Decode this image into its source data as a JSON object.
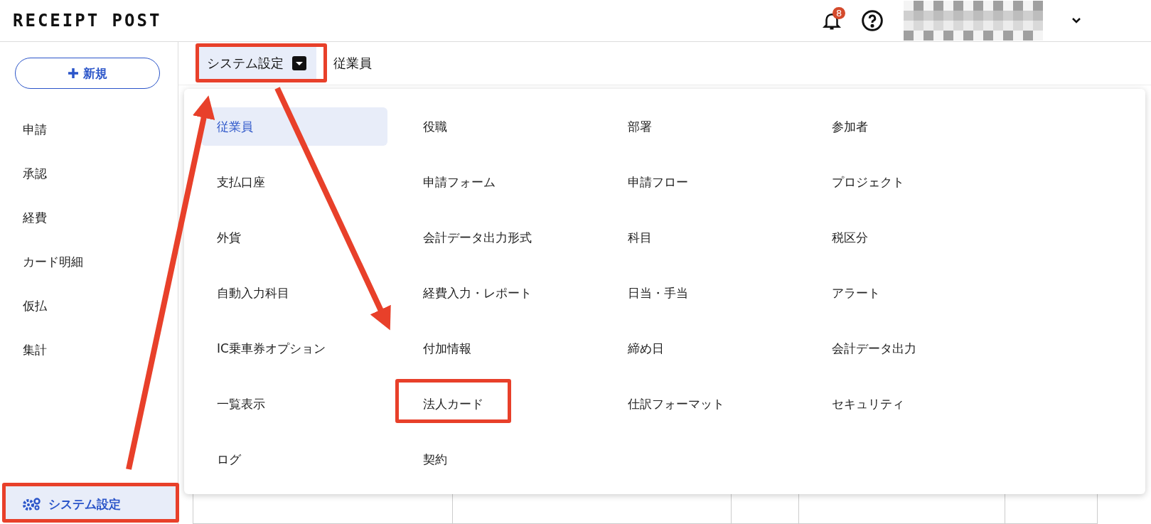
{
  "header": {
    "logo": "RECEIPT POST",
    "notification_count": "8"
  },
  "sidebar": {
    "new_button": "新規",
    "items": [
      {
        "label": "申請",
        "selected": false
      },
      {
        "label": "承認",
        "selected": false
      },
      {
        "label": "経費",
        "selected": false
      },
      {
        "label": "カード明細",
        "selected": false
      },
      {
        "label": "仮払",
        "selected": false
      },
      {
        "label": "集計",
        "selected": false
      }
    ],
    "bottom_item": {
      "label": "システム設定",
      "selected": true
    }
  },
  "tabs": [
    {
      "label": "システム設定",
      "kind": "dropdown",
      "selected": true
    },
    {
      "label": "従業員",
      "kind": "plain",
      "selected": false
    }
  ],
  "menu_items": [
    {
      "label": "従業員",
      "selected": true
    },
    {
      "label": "役職",
      "selected": false
    },
    {
      "label": "部署",
      "selected": false
    },
    {
      "label": "参加者",
      "selected": false
    },
    {
      "label": "支払口座",
      "selected": false
    },
    {
      "label": "申請フォーム",
      "selected": false
    },
    {
      "label": "申請フロー",
      "selected": false
    },
    {
      "label": "プロジェクト",
      "selected": false
    },
    {
      "label": "外貨",
      "selected": false
    },
    {
      "label": "会計データ出力形式",
      "selected": false
    },
    {
      "label": "科目",
      "selected": false
    },
    {
      "label": "税区分",
      "selected": false
    },
    {
      "label": "自動入力科目",
      "selected": false
    },
    {
      "label": "経費入力・レポート",
      "selected": false
    },
    {
      "label": "日当・手当",
      "selected": false
    },
    {
      "label": "アラート",
      "selected": false
    },
    {
      "label": "IC乗車券オプション",
      "selected": false
    },
    {
      "label": "付加情報",
      "selected": false
    },
    {
      "label": "締め日",
      "selected": false
    },
    {
      "label": "会計データ出力",
      "selected": false
    },
    {
      "label": "一覧表示",
      "selected": false
    },
    {
      "label": "法人カード",
      "selected": false
    },
    {
      "label": "仕訳フォーマット",
      "selected": false
    },
    {
      "label": "セキュリティ",
      "selected": false
    },
    {
      "label": "ログ",
      "selected": false
    },
    {
      "label": "契約",
      "selected": false
    }
  ]
}
